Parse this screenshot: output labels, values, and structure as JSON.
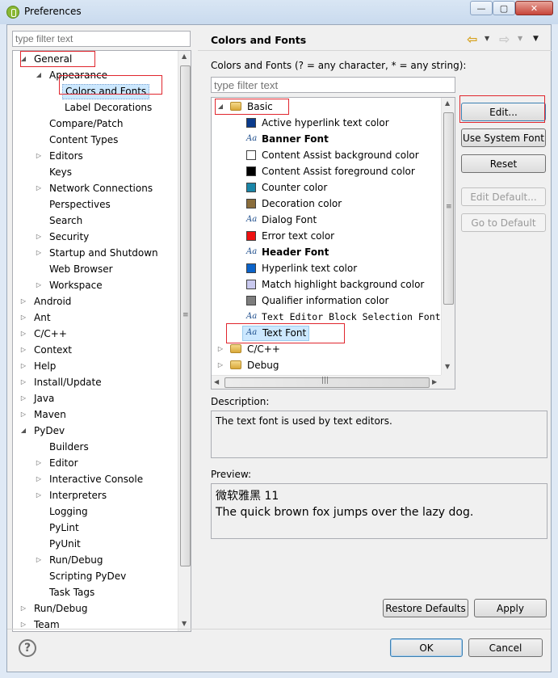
{
  "window": {
    "title": "Preferences",
    "controls": {
      "minimize": "—",
      "maximize": "▢",
      "close": "✕"
    }
  },
  "left": {
    "filter_placeholder": "type filter text",
    "tree": [
      {
        "label": "General",
        "level": 0,
        "toggle": "expanded",
        "boxed": true
      },
      {
        "label": "Appearance",
        "level": 1,
        "toggle": "expanded"
      },
      {
        "label": "Colors and Fonts",
        "level": 2,
        "toggle": "none",
        "boxed": true,
        "selected": true
      },
      {
        "label": "Label Decorations",
        "level": 2,
        "toggle": "none"
      },
      {
        "label": "Compare/Patch",
        "level": 1,
        "toggle": "none"
      },
      {
        "label": "Content Types",
        "level": 1,
        "toggle": "none"
      },
      {
        "label": "Editors",
        "level": 1,
        "toggle": "collapsed"
      },
      {
        "label": "Keys",
        "level": 1,
        "toggle": "none"
      },
      {
        "label": "Network Connections",
        "level": 1,
        "toggle": "collapsed"
      },
      {
        "label": "Perspectives",
        "level": 1,
        "toggle": "none"
      },
      {
        "label": "Search",
        "level": 1,
        "toggle": "none"
      },
      {
        "label": "Security",
        "level": 1,
        "toggle": "collapsed"
      },
      {
        "label": "Startup and Shutdown",
        "level": 1,
        "toggle": "collapsed"
      },
      {
        "label": "Web Browser",
        "level": 1,
        "toggle": "none"
      },
      {
        "label": "Workspace",
        "level": 1,
        "toggle": "collapsed"
      },
      {
        "label": "Android",
        "level": 0,
        "toggle": "collapsed"
      },
      {
        "label": "Ant",
        "level": 0,
        "toggle": "collapsed"
      },
      {
        "label": "C/C++",
        "level": 0,
        "toggle": "collapsed"
      },
      {
        "label": "Context",
        "level": 0,
        "toggle": "collapsed"
      },
      {
        "label": "Help",
        "level": 0,
        "toggle": "collapsed"
      },
      {
        "label": "Install/Update",
        "level": 0,
        "toggle": "collapsed"
      },
      {
        "label": "Java",
        "level": 0,
        "toggle": "collapsed"
      },
      {
        "label": "Maven",
        "level": 0,
        "toggle": "collapsed"
      },
      {
        "label": "PyDev",
        "level": 0,
        "toggle": "expanded"
      },
      {
        "label": "Builders",
        "level": 1,
        "toggle": "none"
      },
      {
        "label": "Editor",
        "level": 1,
        "toggle": "collapsed"
      },
      {
        "label": "Interactive Console",
        "level": 1,
        "toggle": "collapsed"
      },
      {
        "label": "Interpreters",
        "level": 1,
        "toggle": "collapsed"
      },
      {
        "label": "Logging",
        "level": 1,
        "toggle": "none"
      },
      {
        "label": "PyLint",
        "level": 1,
        "toggle": "none"
      },
      {
        "label": "PyUnit",
        "level": 1,
        "toggle": "none"
      },
      {
        "label": "Run/Debug",
        "level": 1,
        "toggle": "collapsed"
      },
      {
        "label": "Scripting PyDev",
        "level": 1,
        "toggle": "none"
      },
      {
        "label": "Task Tags",
        "level": 1,
        "toggle": "none"
      },
      {
        "label": "Run/Debug",
        "level": 0,
        "toggle": "collapsed"
      },
      {
        "label": "Team",
        "level": 0,
        "toggle": "collapsed"
      }
    ]
  },
  "right": {
    "title": "Colors and Fonts",
    "nav": {
      "back": "⇦",
      "forward": "⇨",
      "menu": "▼"
    },
    "hint": "Colors and Fonts (? = any character, * = any string):",
    "filter_placeholder": "type filter text",
    "tree": [
      {
        "label": "Basic",
        "kind": "category",
        "toggle": "expanded",
        "boxed": true
      },
      {
        "label": "Active hyperlink text color",
        "kind": "color",
        "color": "#0a3b8c"
      },
      {
        "label": "Banner Font",
        "kind": "font",
        "bold": true
      },
      {
        "label": "Content Assist background color",
        "kind": "color",
        "color": "#ffffff"
      },
      {
        "label": "Content Assist foreground color",
        "kind": "color",
        "color": "#000000"
      },
      {
        "label": "Counter color",
        "kind": "color",
        "color": "#1a86a8"
      },
      {
        "label": "Decoration color",
        "kind": "color",
        "color": "#8a6d3b"
      },
      {
        "label": "Dialog Font",
        "kind": "font"
      },
      {
        "label": "Error text color",
        "kind": "color",
        "color": "#ee1111"
      },
      {
        "label": "Header Font",
        "kind": "font",
        "bold": true
      },
      {
        "label": "Hyperlink text color",
        "kind": "color",
        "color": "#0b63c9"
      },
      {
        "label": "Match highlight background color",
        "kind": "color",
        "color": "#c9c9ef"
      },
      {
        "label": "Qualifier information color",
        "kind": "color",
        "color": "#7d7d7d"
      },
      {
        "label": "Text Editor Block Selection Font",
        "kind": "font",
        "mono": true
      },
      {
        "label": "Text Font",
        "kind": "font",
        "selected": true,
        "boxed": true
      },
      {
        "label": "C/C++",
        "kind": "category",
        "toggle": "collapsed"
      },
      {
        "label": "Debug",
        "kind": "category",
        "toggle": "collapsed"
      }
    ],
    "buttons": {
      "edit": "Edit...",
      "use_system_font": "Use System Font",
      "reset": "Reset",
      "edit_default": "Edit Default...",
      "go_to_default": "Go to Default"
    },
    "description_label": "Description:",
    "description_text": "The text font is used by text editors.",
    "preview_label": "Preview:",
    "preview_lines": [
      "微软雅黑 11",
      "The quick brown fox jumps over the lazy dog."
    ],
    "restore_defaults": "Restore Defaults",
    "apply": "Apply"
  },
  "footer": {
    "help": "?",
    "ok": "OK",
    "cancel": "Cancel"
  },
  "colors": {
    "selection": "#cce8ff",
    "annotation_red": "#e0262e"
  }
}
